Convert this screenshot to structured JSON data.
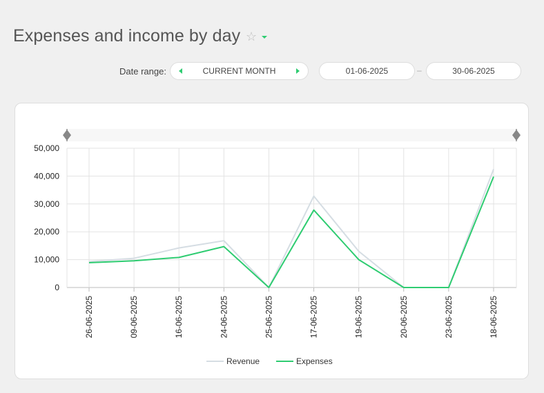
{
  "header": {
    "title": "Expenses and income by day"
  },
  "filters": {
    "date_range_label": "Date range:",
    "range_value": "CURRENT MONTH",
    "from_date": "01-06-2025",
    "to_date": "30-06-2025"
  },
  "icons": {
    "favorite": "star-outline-icon",
    "title_menu": "caret-down-icon",
    "range_prev": "triangle-left-icon",
    "range_next": "triangle-right-icon",
    "zoom_handle": "diamond-handle-icon"
  },
  "colors": {
    "accent": "#2ecc71",
    "revenue": "#d5dde3",
    "expenses": "#2ecc71"
  },
  "chart_data": {
    "type": "line",
    "categories": [
      "26-06-2025",
      "09-06-2025",
      "16-06-2025",
      "24-06-2025",
      "25-06-2025",
      "17-06-2025",
      "19-06-2025",
      "20-06-2025",
      "23-06-2025",
      "18-06-2025"
    ],
    "series": [
      {
        "name": "Revenue",
        "color": "#d5dde3",
        "values": [
          9300,
          10500,
          14200,
          16800,
          0,
          32800,
          13000,
          0,
          0,
          42500
        ]
      },
      {
        "name": "Expenses",
        "color": "#2ecc71",
        "values": [
          8900,
          9600,
          10800,
          14700,
          0,
          27800,
          10000,
          0,
          0,
          39800
        ]
      }
    ],
    "y_ticks": [
      "50,000",
      "40,000",
      "30,000",
      "20,000",
      "10,000",
      "0"
    ],
    "ylim": [
      0,
      50000
    ],
    "grid": true,
    "legend": "bottom-center"
  }
}
